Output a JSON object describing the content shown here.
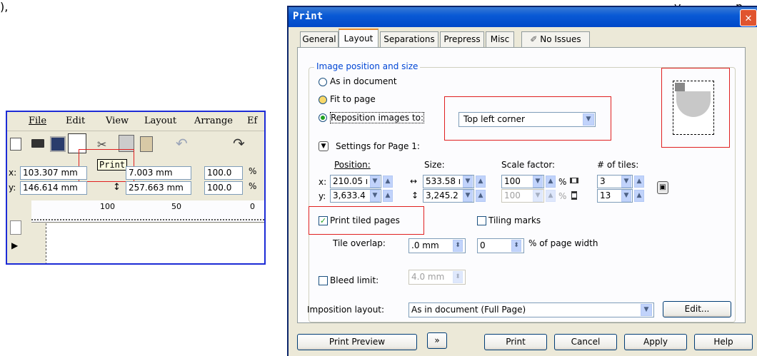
{
  "top_fragment": "),",
  "top_fragment2": "y",
  "top_fragment3": "p",
  "snippet": {
    "menu": [
      "File",
      "Edit",
      "View",
      "Layout",
      "Arrange",
      "Ef"
    ],
    "tooltip": "Print",
    "x_label": "x:",
    "x_value": "103.307 mm",
    "y_label": "y:",
    "y_value": "146.614 mm",
    "w_value": "7.003 mm",
    "h_value": "257.663 mm",
    "scale1": "100.0",
    "scale2": "100.0",
    "pct": "%",
    "ruler": [
      "100",
      "50",
      "0"
    ]
  },
  "dialog": {
    "title": "Print",
    "close_glyph": "✕",
    "tabs": [
      "General",
      "Layout",
      "Separations",
      "Prepress",
      "Misc",
      "No Issues"
    ],
    "group_title": "Image position and size",
    "radio_as_in_document": "As in document",
    "radio_fit_to_page": "Fit to page",
    "radio_reposition": "Reposition images to:",
    "reposition_value": "Top left corner",
    "settings_label": "Settings for Page 1:",
    "position_label": "Position:",
    "size_label": "Size:",
    "scale_label": "Scale factor:",
    "tiles_label": "# of tiles:",
    "x_label": "x:",
    "y_label": "y:",
    "pos_x": "210.05 ı",
    "pos_y": "3,633.4",
    "size_w": "533.58 ı",
    "size_h": "3,245.2",
    "scale_x": "100",
    "scale_y": "100",
    "pct": "%",
    "tiles_x": "3",
    "tiles_y": "13",
    "print_tiled": "Print tiled pages",
    "tiling_marks": "Tiling marks",
    "tile_overlap_label": "Tile overlap:",
    "tile_overlap_value": ".0 mm",
    "tile_overlap_pct": "0",
    "page_width_label": "% of page width",
    "bleed_label": "Bleed limit:",
    "bleed_value": "4.0 mm",
    "imposition_label": "Imposition layout:",
    "imposition_value": "As in document (Full Page)",
    "edit_button": "Edit...",
    "print_preview": "Print Preview",
    "preview_arrow": "»",
    "print_button": "Print",
    "cancel_button": "Cancel",
    "apply_button": "Apply",
    "help_button": "Help"
  },
  "colors": {
    "accent_red": "#e02020",
    "title_blue": "#0a5ad5",
    "snippet_border": "#1c2bd6"
  }
}
